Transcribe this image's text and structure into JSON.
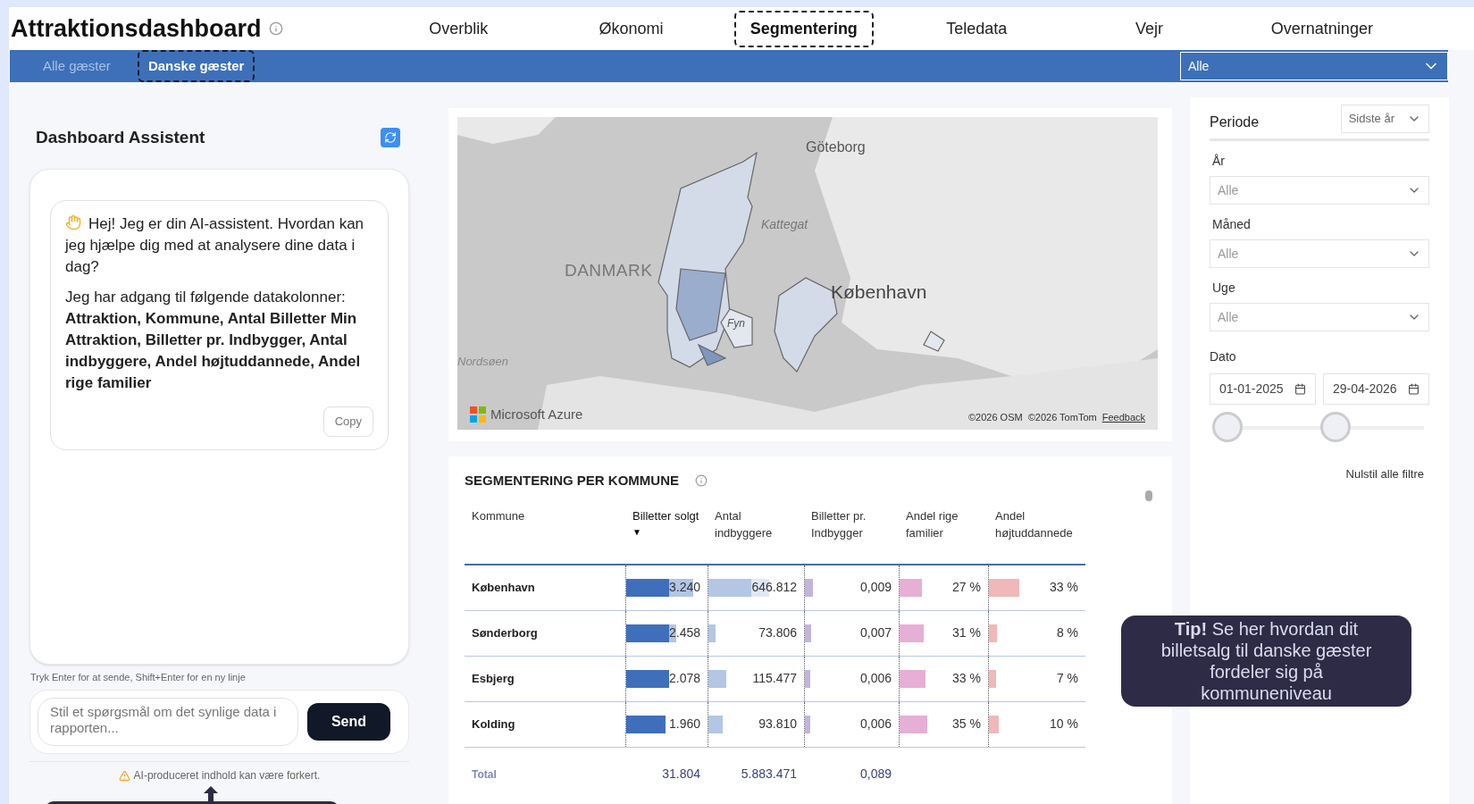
{
  "header": {
    "title": "Attraktionsdashboard",
    "tabs": [
      {
        "label": "Overblik",
        "selected": false
      },
      {
        "label": "Økonomi",
        "selected": false
      },
      {
        "label": "Segmentering",
        "selected": true
      },
      {
        "label": "Teledata",
        "selected": false
      },
      {
        "label": "Vejr",
        "selected": false
      },
      {
        "label": "Overnatninger",
        "selected": false
      }
    ]
  },
  "subnav": {
    "tabs": [
      {
        "label": "Alle gæster",
        "selected": false
      },
      {
        "label": "Danske gæster",
        "selected": true
      }
    ],
    "dropdown": "Alle"
  },
  "assistant": {
    "title": "Dashboard Assistent",
    "greeting": "Hej! Jeg er din AI-assistent. Hvordan kan jeg hjælpe dig med at analysere dine data i dag?",
    "intro": "Jeg har adgang til følgende datakolonner:",
    "columns": "Attraktion, Kommune, Antal Billetter Min Attraktion, Billetter pr. Indbygger, Antal indbyggere, Andel højtuddannede, Andel rige familier",
    "copy": "Copy",
    "hint": "Tryk Enter for at sende, Shift+Enter for en ny linje",
    "placeholder": "Stil et spørgsmål om det synlige data i rapporten...",
    "send": "Send",
    "warning": "AI-produceret indhold kan være forkert."
  },
  "map": {
    "labels": [
      {
        "kind": "city",
        "text": "Göteborg"
      },
      {
        "kind": "sea",
        "text": "Kattegat"
      },
      {
        "kind": "country",
        "text": "DANMARK"
      },
      {
        "kind": "capital",
        "text": "København"
      },
      {
        "kind": "island",
        "text": "Fyn"
      },
      {
        "kind": "sea2",
        "text": "Nordsøen"
      }
    ],
    "brand": "Microsoft Azure",
    "attributions": [
      "©2026 OSM",
      "©2026 TomTom"
    ],
    "feedback": "Feedback"
  },
  "table": {
    "title": "SEGMENTERING PER KOMMUNE",
    "columns": [
      {
        "label": "Kommune",
        "sorted": false
      },
      {
        "label": "Billetter solgt",
        "sorted": true
      },
      {
        "label": "Antal indbyggere",
        "sorted": false
      },
      {
        "label": "Billetter pr. Indbygger",
        "sorted": false
      },
      {
        "label": "Andel rige familier",
        "sorted": false
      },
      {
        "label": "Andel højtuddannede",
        "sorted": false
      }
    ],
    "sort_caret": "▼",
    "rows": [
      {
        "cells": [
          {
            "text": "København",
            "kind": "name"
          },
          {
            "text": "3.240",
            "level": 0.88
          },
          {
            "text": "646.812",
            "level": 0.67
          },
          {
            "text": "0,009",
            "level": 0.09
          },
          {
            "text": "27 %",
            "level": 0.27
          },
          {
            "text": "33 %",
            "level": 0.33
          }
        ]
      },
      {
        "cells": [
          {
            "text": "Sønderborg",
            "kind": "name"
          },
          {
            "text": "2.458",
            "level": 0.66
          },
          {
            "text": "73.806",
            "level": 0.08
          },
          {
            "text": "0,007",
            "level": 0.07
          },
          {
            "text": "31 %",
            "level": 0.29
          },
          {
            "text": "8 %",
            "level": 0.09
          }
        ]
      },
      {
        "cells": [
          {
            "text": "Esbjerg",
            "kind": "name"
          },
          {
            "text": "2.078",
            "level": 0.56
          },
          {
            "text": "115.477",
            "level": 0.2
          },
          {
            "text": "0,006",
            "level": 0.06
          },
          {
            "text": "33 %",
            "level": 0.31
          },
          {
            "text": "7 %",
            "level": 0.08
          }
        ]
      },
      {
        "cells": [
          {
            "text": "Kolding",
            "kind": "name"
          },
          {
            "text": "1.960",
            "level": 0.52
          },
          {
            "text": "93.810",
            "level": 0.16
          },
          {
            "text": "0,006",
            "level": 0.06
          },
          {
            "text": "35 %",
            "level": 0.33
          },
          {
            "text": "10 %",
            "level": 0.11
          }
        ]
      }
    ],
    "total": {
      "label": "Total",
      "values": [
        "31.804",
        "5.883.471",
        "0,089"
      ]
    }
  },
  "filters": {
    "period_label": "Periode",
    "period_value": "Sidste år",
    "dropdowns": [
      {
        "label": "År",
        "value": "Alle"
      },
      {
        "label": "Måned",
        "value": "Alle"
      },
      {
        "label": "Uge",
        "value": "Alle"
      }
    ],
    "date_label": "Dato",
    "from": "01-01-2025",
    "to": "29-04-2026",
    "thumbs": [
      {
        "level": 0
      },
      {
        "level": 0.55
      }
    ],
    "reset": "Nulstil alle filtre"
  },
  "tip": "**Tip!** Se her hvordan dit billetsalg til danske gæster fordeler sig på kommuneniveau"
}
